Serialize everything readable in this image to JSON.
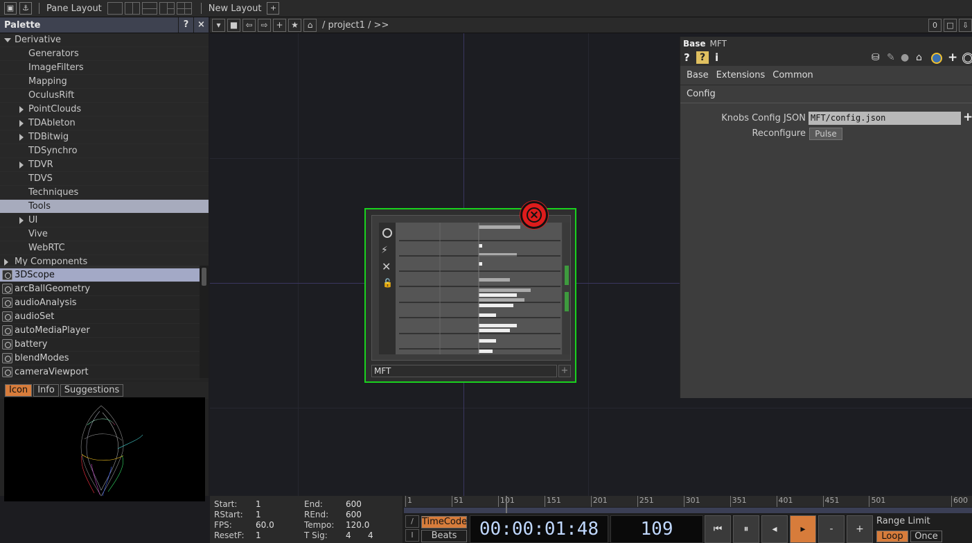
{
  "topbar": {
    "pane_layout_label": "Pane Layout",
    "new_layout_label": "New Layout",
    "new_layout_plus": "+"
  },
  "palette": {
    "title": "Palette",
    "help": "?",
    "close": "×",
    "tree": [
      {
        "label": "Derivative",
        "level": 0,
        "expander": "open",
        "selected": false
      },
      {
        "label": "Generators",
        "level": 1,
        "expander": "none",
        "selected": false
      },
      {
        "label": "ImageFilters",
        "level": 1,
        "expander": "none",
        "selected": false
      },
      {
        "label": "Mapping",
        "level": 1,
        "expander": "none",
        "selected": false
      },
      {
        "label": "OculusRift",
        "level": 1,
        "expander": "none",
        "selected": false
      },
      {
        "label": "PointClouds",
        "level": 1,
        "expander": "closed",
        "selected": false
      },
      {
        "label": "TDAbleton",
        "level": 1,
        "expander": "closed",
        "selected": false
      },
      {
        "label": "TDBitwig",
        "level": 1,
        "expander": "closed",
        "selected": false
      },
      {
        "label": "TDSynchro",
        "level": 1,
        "expander": "none",
        "selected": false
      },
      {
        "label": "TDVR",
        "level": 1,
        "expander": "closed",
        "selected": false
      },
      {
        "label": "TDVS",
        "level": 1,
        "expander": "none",
        "selected": false
      },
      {
        "label": "Techniques",
        "level": 1,
        "expander": "none",
        "selected": false
      },
      {
        "label": "Tools",
        "level": 1,
        "expander": "none",
        "selected": true
      },
      {
        "label": "UI",
        "level": 1,
        "expander": "closed",
        "selected": false
      },
      {
        "label": "Vive",
        "level": 1,
        "expander": "none",
        "selected": false
      },
      {
        "label": "WebRTC",
        "level": 1,
        "expander": "none",
        "selected": false
      },
      {
        "label": "My Components",
        "level": 0,
        "expander": "closed",
        "selected": false
      }
    ],
    "components": [
      {
        "label": "3DScope",
        "selected": true
      },
      {
        "label": "arcBallGeometry",
        "selected": false
      },
      {
        "label": "audioAnalysis",
        "selected": false
      },
      {
        "label": "audioSet",
        "selected": false
      },
      {
        "label": "autoMediaPlayer",
        "selected": false
      },
      {
        "label": "battery",
        "selected": false
      },
      {
        "label": "blendModes",
        "selected": false
      },
      {
        "label": "cameraViewport",
        "selected": false
      }
    ],
    "info_tabs": [
      {
        "label": "Icon",
        "active": true
      },
      {
        "label": "Info",
        "active": false
      },
      {
        "label": "Suggestions",
        "active": false
      }
    ]
  },
  "network": {
    "path": "/ project1 / >>",
    "counter": "0"
  },
  "node": {
    "name": "MFT",
    "plus": "+",
    "error_symbol": "×"
  },
  "params": {
    "op_type": "Base",
    "op_name": "MFT",
    "tabs": [
      "Base",
      "Extensions",
      "Common"
    ],
    "subtab": "Config",
    "knobs_label": "Knobs Config JSON",
    "knobs_value": "MFT/config.json",
    "reconfigure_label": "Reconfigure",
    "pulse_label": "Pulse"
  },
  "timeline": {
    "start_label": "Start:",
    "start_value": "1",
    "end_label": "End:",
    "end_value": "600",
    "rstart_label": "RStart:",
    "rstart_value": "1",
    "rend_label": "REnd:",
    "rend_value": "600",
    "fps_label": "FPS:",
    "fps_value": "60.0",
    "tempo_label": "Tempo:",
    "tempo_value": "120.0",
    "resetf_label": "ResetF:",
    "resetf_value": "1",
    "tsig_label": "T Sig:",
    "tsig_value1": "4",
    "tsig_value2": "4",
    "ruler_ticks": [
      "1",
      "51",
      "101",
      "151",
      "201",
      "251",
      "301",
      "351",
      "401",
      "451",
      "501",
      "600"
    ],
    "timecode_btn": "TimeCode",
    "beats_btn": "Beats",
    "timecode": "00:00:01:48",
    "frame": "109",
    "minus": "-",
    "plus": "+",
    "range_limit_label": "Range Limit",
    "loop_label": "Loop",
    "once_label": "Once"
  },
  "colors": {
    "accent": "#d77c3b",
    "node_border": "#19d21e",
    "error": "#dd1c1c",
    "selection": "#a7abbd"
  }
}
